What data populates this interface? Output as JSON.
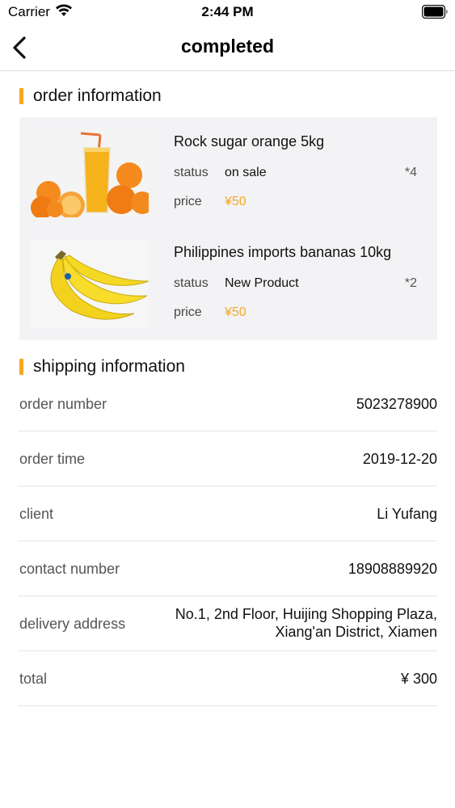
{
  "status_bar": {
    "carrier": "Carrier",
    "time": "2:44 PM"
  },
  "nav": {
    "title": "completed",
    "back_icon": "chevron-left-icon"
  },
  "order_section": {
    "title": "order information",
    "accent_color": "#f5a623"
  },
  "products": [
    {
      "name": "Rock sugar orange 5kg",
      "status_label": "status",
      "status": "on sale",
      "quantity": "*4",
      "price_label": "price",
      "price": "¥50",
      "image": "orange-juice-image"
    },
    {
      "name": "Philippines imports bananas 10kg",
      "status_label": "status",
      "status": "New Product",
      "quantity": "*2",
      "price_label": "price",
      "price": "¥50",
      "image": "bananas-image"
    }
  ],
  "shipping_section": {
    "title": "shipping information"
  },
  "shipping": {
    "order_number_label": "order number",
    "order_number": "5023278900",
    "order_time_label": "order time",
    "order_time": "2019-12-20",
    "client_label": "client",
    "client": "Li Yufang",
    "contact_label": "contact number",
    "contact": "18908889920",
    "address_label": "delivery address",
    "address_line1": "No.1, 2nd Floor, Huijing Shopping Plaza,",
    "address_line2": "Xiang'an District, Xiamen",
    "total_label": "total",
    "total": "¥ 300"
  }
}
